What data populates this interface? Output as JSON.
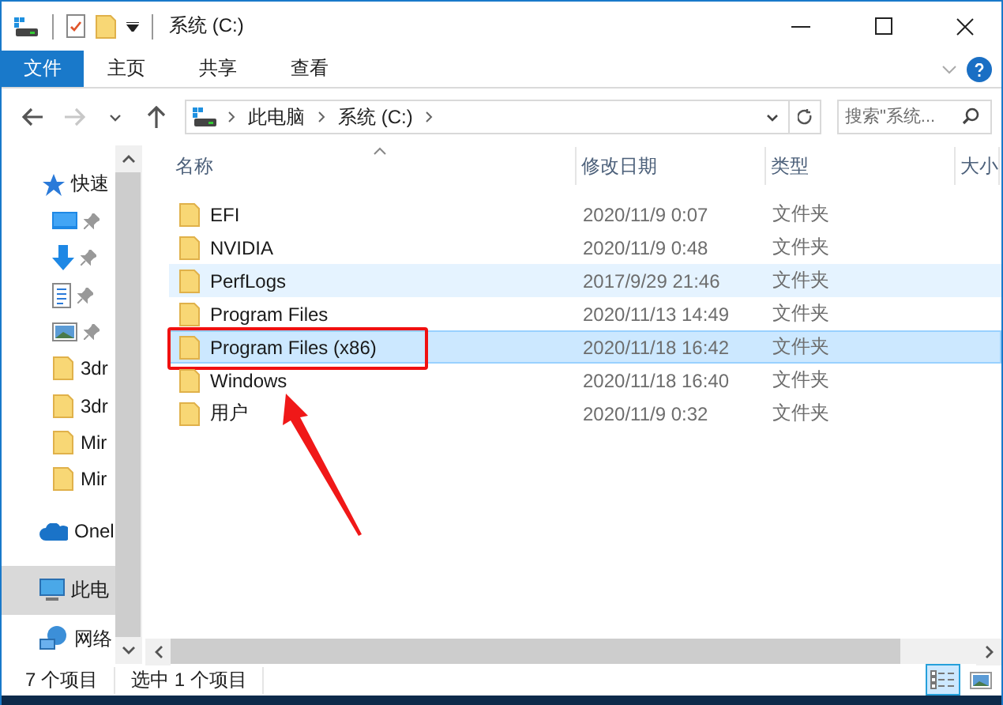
{
  "window": {
    "title": "系统 (C:)"
  },
  "ribbon": {
    "tabs": [
      {
        "label": "文件",
        "kind": "file"
      },
      {
        "label": "主页",
        "kind": "tab"
      },
      {
        "label": "共享",
        "kind": "tab"
      },
      {
        "label": "查看",
        "kind": "tab"
      }
    ]
  },
  "nav_buttons": [
    {
      "kind": "back",
      "disabled": false
    },
    {
      "kind": "forward",
      "disabled": true
    },
    {
      "kind": "recent",
      "disabled": false
    },
    {
      "kind": "up",
      "disabled": false
    }
  ],
  "address": {
    "path": [
      "此电脑",
      "系统 (C:)"
    ]
  },
  "search": {
    "placeholder": "搜索\"系统..."
  },
  "sidebar": {
    "items": [
      {
        "label": "快速",
        "kind": "star",
        "selected": false
      },
      {
        "kind": "desktop",
        "selected": false
      },
      {
        "kind": "download",
        "selected": false
      },
      {
        "kind": "document",
        "selected": false
      },
      {
        "kind": "image",
        "selected": false
      },
      {
        "label": "3dr",
        "kind": "folder",
        "selected": false
      },
      {
        "label": "3dr",
        "kind": "folder",
        "selected": false
      },
      {
        "label": "Mir",
        "kind": "folder",
        "selected": false
      },
      {
        "label": "Mir",
        "kind": "folder",
        "selected": false
      },
      {
        "label": "Onel",
        "kind": "cloud",
        "selected": false
      },
      {
        "label": "此电",
        "kind": "computer",
        "selected": true
      },
      {
        "label": "网络",
        "kind": "network",
        "selected": false
      }
    ]
  },
  "columns": [
    {
      "label": "名称",
      "sorted": true
    },
    {
      "label": "修改日期",
      "sorted": false
    },
    {
      "label": "类型",
      "sorted": false
    },
    {
      "label": "大小",
      "sorted": false
    }
  ],
  "rows": [
    {
      "name": "EFI",
      "date": "2020/11/9 0:07",
      "type": "文件夹",
      "selected": false,
      "hovered": false,
      "annotated": false
    },
    {
      "name": "NVIDIA",
      "date": "2020/11/9 0:48",
      "type": "文件夹",
      "selected": false,
      "hovered": false,
      "annotated": false
    },
    {
      "name": "PerfLogs",
      "date": "2017/9/29 21:46",
      "type": "文件夹",
      "selected": false,
      "hovered": true,
      "annotated": false
    },
    {
      "name": "Program Files",
      "date": "2020/11/13 14:49",
      "type": "文件夹",
      "selected": false,
      "hovered": false,
      "annotated": false
    },
    {
      "name": "Program Files (x86)",
      "date": "2020/11/18 16:42",
      "type": "文件夹",
      "selected": true,
      "hovered": false,
      "annotated": true
    },
    {
      "name": "Windows",
      "date": "2020/11/18 16:40",
      "type": "文件夹",
      "selected": false,
      "hovered": false,
      "annotated": false
    },
    {
      "name": "用户",
      "date": "2020/11/9 0:32",
      "type": "文件夹",
      "selected": false,
      "hovered": false,
      "annotated": false
    }
  ],
  "status_bar": {
    "count": "7 个项目",
    "selection": "选中 1 个项目"
  },
  "view_buttons": [
    {
      "kind": "details",
      "selected": true
    },
    {
      "kind": "tiles",
      "selected": false
    }
  ]
}
